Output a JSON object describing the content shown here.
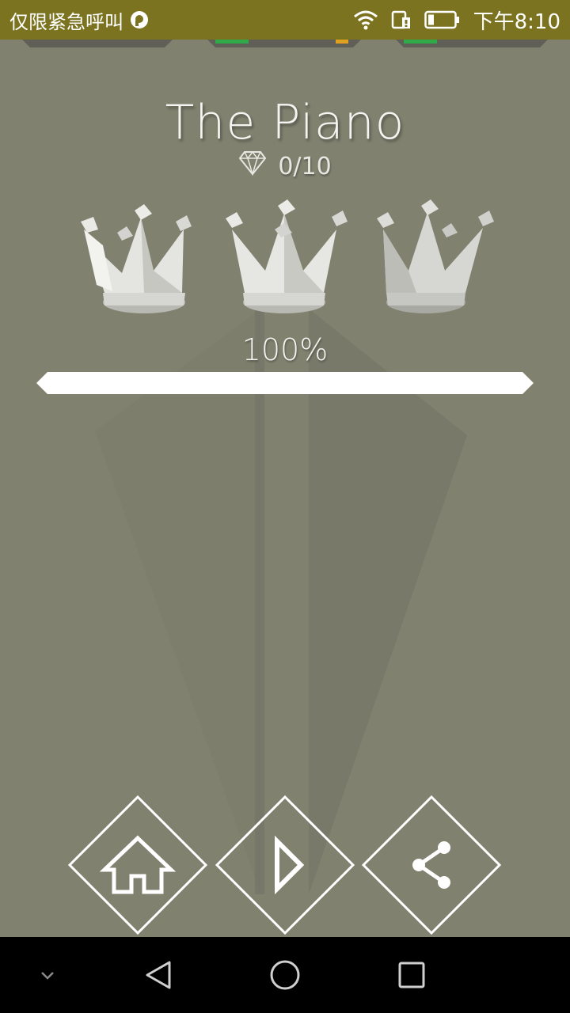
{
  "status_bar": {
    "carrier_text": "仅限紧急呼叫",
    "time": "下午8:10"
  },
  "level": {
    "title": "The Piano",
    "gems_collected": 0,
    "gems_total": 10,
    "gems_text": "0/10",
    "crowns_earned": 3,
    "progress_text": "100%",
    "progress_fraction": 1.0
  },
  "actions": {
    "home_icon": "home-icon",
    "play_icon": "play-icon",
    "share_icon": "share-icon"
  },
  "nav": {
    "hide_icon": "chevron-down-icon",
    "back_icon": "back-triangle-icon",
    "home_icon": "home-circle-icon",
    "recents_icon": "recents-square-icon"
  },
  "colors": {
    "background": "#80816f",
    "status_bar": "#7b7320",
    "accent": "#ffffff"
  }
}
